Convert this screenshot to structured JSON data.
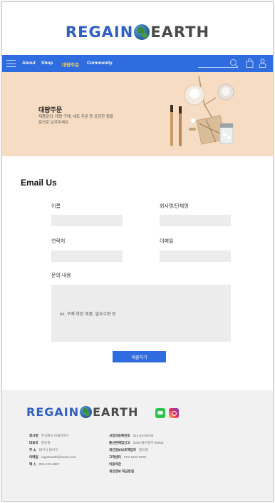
{
  "brand": {
    "logo_part1": "Regain",
    "logo_part2": "earth"
  },
  "nav": {
    "items": [
      {
        "label": "About"
      },
      {
        "label": "Shop"
      },
      {
        "label": "대량주문"
      },
      {
        "label": "Community"
      }
    ],
    "active_item": "대량주문"
  },
  "banner": {
    "title": "대량주문",
    "desc": "제품문의, 대량 구매, 세트 주문 등 궁금한 점을 문의로 남겨주세요"
  },
  "form": {
    "title": "Email Us",
    "name_label": "이름",
    "company_label": "회사명/단체명",
    "phone_label": "연락처",
    "email_label": "이메일",
    "content_label": "문의 내용",
    "content_placeholder": "ex. 구매 희망 제품, 필요수량 등",
    "submit_label": "제출하기"
  },
  "footer": {
    "left": [
      {
        "key": "회사명",
        "value": "주식회사 리게인어스"
      },
      {
        "key": "대표자",
        "value": "정유경"
      },
      {
        "key": "주 소",
        "value": "대구시 달서구"
      },
      {
        "key": "이메일",
        "value": "regainearth@naver.com"
      },
      {
        "key": "팩 스",
        "value": "053-123-4567"
      }
    ],
    "right": [
      {
        "key": "사업자등록번호",
        "value": "012-34-56789"
      },
      {
        "key": "통신판매업신고",
        "value": "2025-대구중부-00002"
      },
      {
        "key": "개인정보보호책임자",
        "value": "정유경"
      },
      {
        "key": "고객센터",
        "value": "070-1234-5678"
      },
      {
        "key": "이용약관",
        "value": ""
      },
      {
        "key": "개인정보 취급방침",
        "value": ""
      }
    ]
  },
  "colors": {
    "brand_blue": "#2f6ce0",
    "banner_bg": "#f5dcc3",
    "footer_bg": "#f1f1f1",
    "active_nav": "#ffd34d"
  },
  "icons": [
    "menu-icon",
    "search-icon",
    "shopping-bag-icon",
    "user-icon",
    "line-icon",
    "instagram-icon",
    "globe-icon"
  ]
}
